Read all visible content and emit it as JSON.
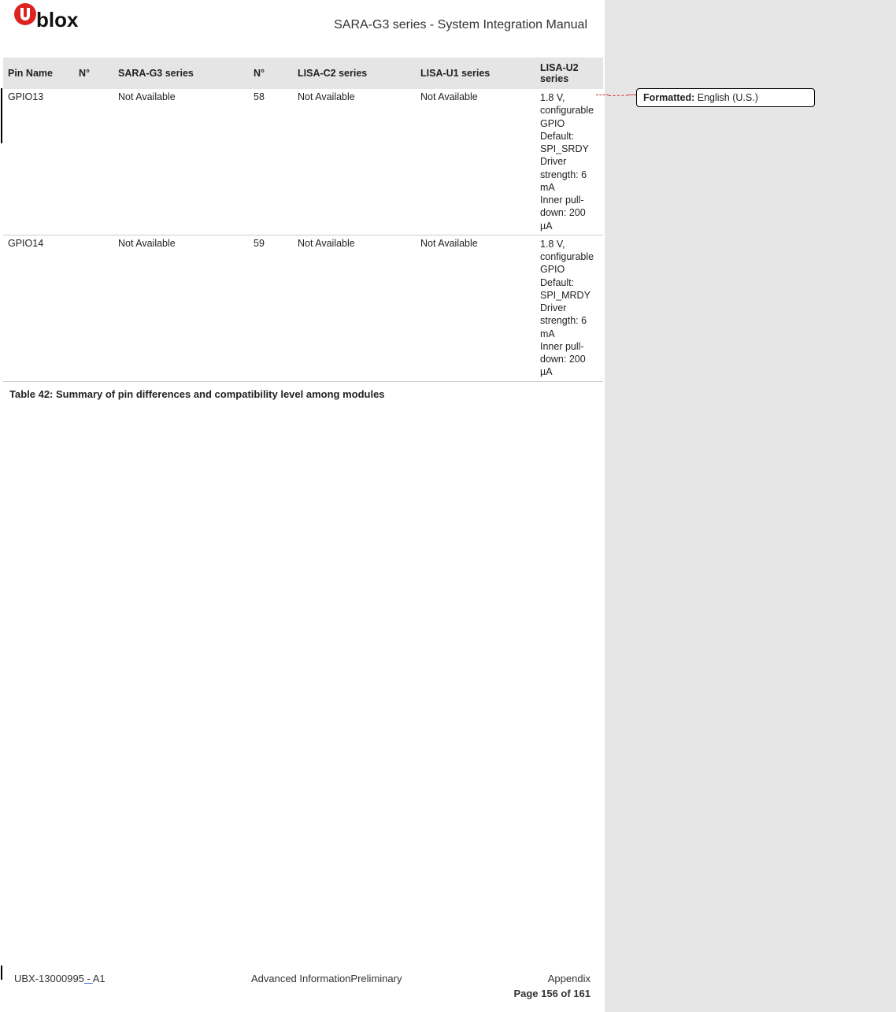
{
  "header": {
    "doc_title": "SARA-G3 series - System Integration Manual"
  },
  "table": {
    "headers": {
      "pin_name": "Pin Name",
      "n1": "N°",
      "sara_g3": "SARA-G3 series",
      "n2": "N°",
      "lisa_c2": "LISA-C2 series",
      "lisa_u1": "LISA-U1 series",
      "lisa_u2": "LISA-U2 series"
    },
    "rows": [
      {
        "pin_name": "GPIO13",
        "n1": "",
        "sara_g3": "Not Available",
        "n2": "58",
        "lisa_c2": "Not Available",
        "lisa_u1": "Not Available",
        "lisa_u2": [
          "1.8 V, configurable GPIO",
          "Default: SPI_SRDY",
          "Driver strength: 6 mA",
          " Inner pull-down: 200 µA"
        ]
      },
      {
        "pin_name": "GPIO14",
        "n1": "",
        "sara_g3": "Not Available",
        "n2": "59",
        "lisa_c2": "Not Available",
        "lisa_u1": "Not Available",
        "lisa_u2": [
          "1.8 V, configurable GPIO",
          "Default: SPI_MRDY",
          "Driver strength: 6 mA",
          "Inner pull-down: 200 µA"
        ]
      }
    ]
  },
  "caption": "Table 42: Summary of pin differences and compatibility level among modules",
  "footer": {
    "doc_id_prefix": "UBX-13000995",
    "doc_id_sep": " - ",
    "doc_id_suffix": "A1",
    "center": "Advanced InformationPreliminary",
    "right": "Appendix",
    "page": "Page 156 of 161"
  },
  "comment": {
    "head": "Formatted:",
    "body": " English (U.S.)"
  }
}
